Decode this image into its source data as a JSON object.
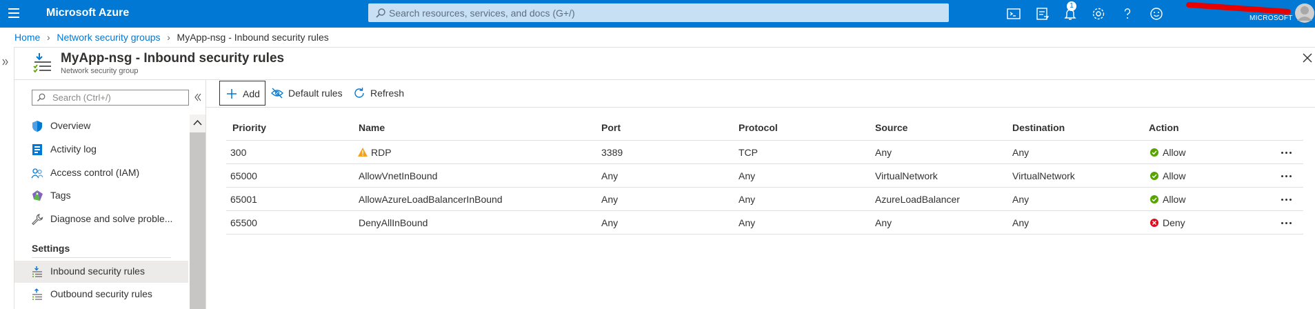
{
  "topbar": {
    "brand": "Microsoft Azure",
    "search_placeholder": "Search resources, services, and docs (G+/)",
    "notification_count": "1",
    "tenant": "MICROSOFT",
    "color": "#0078d4",
    "icons": [
      "cloud-shell-icon",
      "directory-filter-icon",
      "notifications-icon",
      "settings-icon",
      "help-icon",
      "feedback-icon"
    ]
  },
  "breadcrumb": {
    "items": [
      "Home",
      "Network security groups"
    ],
    "current": "MyApp-nsg - Inbound security rules"
  },
  "blade": {
    "title": "MyApp-nsg - Inbound security rules",
    "subtitle": "Network security group"
  },
  "menu": {
    "search_placeholder": "Search (Ctrl+/)",
    "items": [
      {
        "label": "Overview",
        "icon": "shield-icon"
      },
      {
        "label": "Activity log",
        "icon": "activity-log-icon"
      },
      {
        "label": "Access control (IAM)",
        "icon": "people-icon"
      },
      {
        "label": "Tags",
        "icon": "tag-icon"
      },
      {
        "label": "Diagnose and solve proble...",
        "icon": "wrench-icon"
      }
    ],
    "section": "Settings",
    "settings_items": [
      {
        "label": "Inbound security rules",
        "icon": "inbound-rules-icon",
        "selected": true
      },
      {
        "label": "Outbound security rules",
        "icon": "outbound-rules-icon",
        "selected": false
      }
    ]
  },
  "commands": {
    "add": "Add",
    "default_rules": "Default rules",
    "refresh": "Refresh"
  },
  "table": {
    "columns": [
      "Priority",
      "Name",
      "Port",
      "Protocol",
      "Source",
      "Destination",
      "Action"
    ],
    "rows": [
      {
        "priority": "300",
        "name": "RDP",
        "warning": true,
        "port": "3389",
        "protocol": "TCP",
        "source": "Any",
        "destination": "Any",
        "action": "Allow"
      },
      {
        "priority": "65000",
        "name": "AllowVnetInBound",
        "warning": false,
        "port": "Any",
        "protocol": "Any",
        "source": "VirtualNetwork",
        "destination": "VirtualNetwork",
        "action": "Allow"
      },
      {
        "priority": "65001",
        "name": "AllowAzureLoadBalancerInBound",
        "warning": false,
        "port": "Any",
        "protocol": "Any",
        "source": "AzureLoadBalancer",
        "destination": "Any",
        "action": "Allow"
      },
      {
        "priority": "65500",
        "name": "DenyAllInBound",
        "warning": false,
        "port": "Any",
        "protocol": "Any",
        "source": "Any",
        "destination": "Any",
        "action": "Deny"
      }
    ],
    "colors": {
      "allow": "#57a300",
      "deny": "#e00b1c",
      "warning": "#f7a11a"
    }
  }
}
